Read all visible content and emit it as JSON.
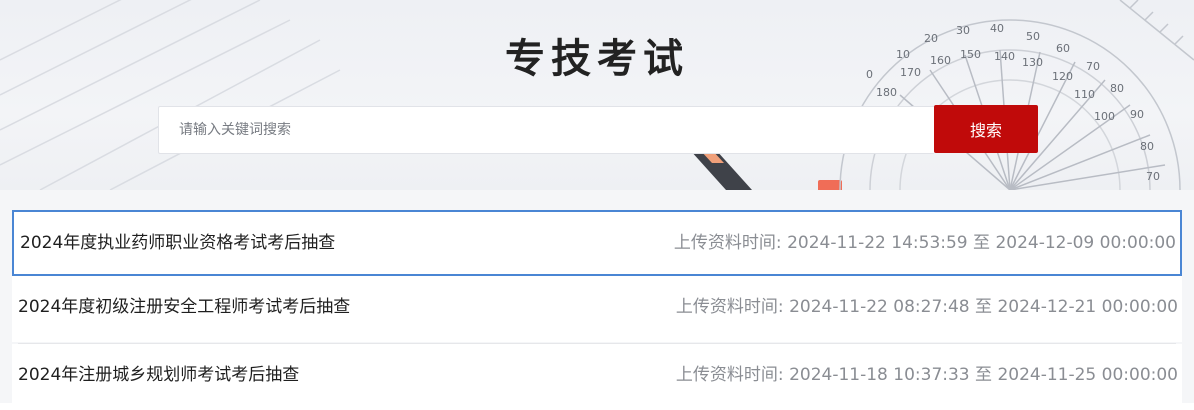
{
  "header": {
    "title": "专技考试"
  },
  "search": {
    "placeholder": "请输入关键词搜索",
    "button_label": "搜索"
  },
  "colors": {
    "accent": "#c00a0a",
    "selected_border": "#4a86d4",
    "time_text": "#8a8d93"
  },
  "list": {
    "time_label": "上传资料时间:",
    "range_sep": "至",
    "items": [
      {
        "title": "2024年度执业药师职业资格考试考后抽查",
        "start": "2024-11-22 14:53:59",
        "end": "2024-12-09 00:00:00",
        "selected": true
      },
      {
        "title": "2024年度初级注册安全工程师考试考后抽查",
        "start": "2024-11-22 08:27:48",
        "end": "2024-12-21 00:00:00",
        "selected": false
      },
      {
        "title": "2024年注册城乡规划师考试考后抽查",
        "start": "2024-11-18 10:37:33",
        "end": "2024-11-25 00:00:00",
        "selected": false
      }
    ]
  }
}
